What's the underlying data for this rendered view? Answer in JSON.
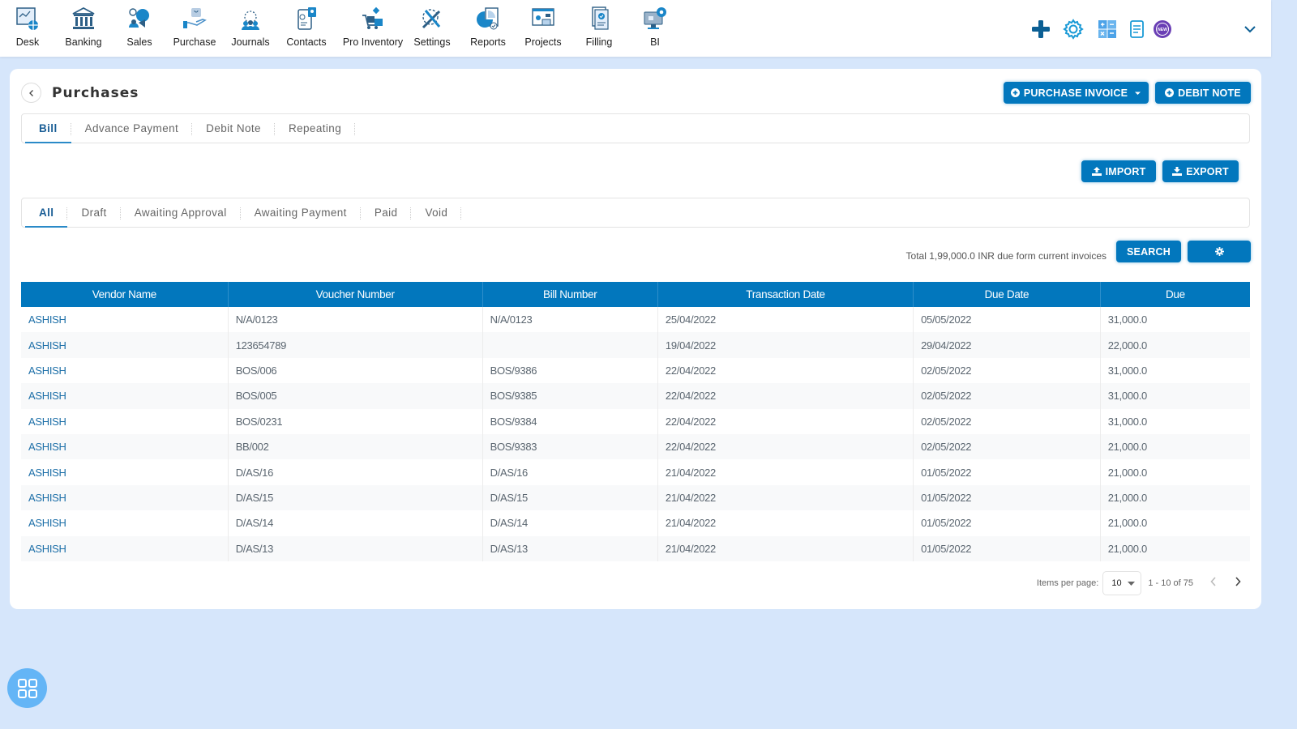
{
  "nav": {
    "items": [
      {
        "label": "Desk",
        "icon": "desk-icon"
      },
      {
        "label": "Banking",
        "icon": "bank-icon"
      },
      {
        "label": "Sales",
        "icon": "sales-icon"
      },
      {
        "label": "Purchase",
        "icon": "purchase-icon"
      },
      {
        "label": "Journals",
        "icon": "journals-icon"
      },
      {
        "label": "Contacts",
        "icon": "contacts-icon"
      },
      {
        "label": "Pro Inventory",
        "icon": "inventory-icon"
      },
      {
        "label": "Settings",
        "icon": "settings-icon"
      },
      {
        "label": "Reports",
        "icon": "reports-icon"
      },
      {
        "label": "Projects",
        "icon": "projects-icon"
      },
      {
        "label": "Filling",
        "icon": "filling-icon"
      },
      {
        "label": "BI",
        "icon": "bi-icon"
      }
    ],
    "tools": [
      "plus-icon",
      "gear-icon",
      "calculator-icon",
      "notes-icon",
      "new-badge-icon",
      "chevron-down-icon"
    ],
    "new_badge_text": "NEW"
  },
  "page": {
    "title": "Purchases",
    "purchase_invoice_label": "PURCHASE INVOICE",
    "debit_note_label": "DEBIT NOTE",
    "import_label": "IMPORT",
    "export_label": "EXPORT",
    "search_label": "SEARCH",
    "total_text": "Total 1,99,000.0 INR due form current invoices"
  },
  "main_tabs": [
    {
      "label": "Bill",
      "active": true
    },
    {
      "label": "Advance Payment",
      "active": false
    },
    {
      "label": "Debit Note",
      "active": false
    },
    {
      "label": "Repeating",
      "active": false
    }
  ],
  "status_tabs": [
    {
      "label": "All",
      "active": true
    },
    {
      "label": "Draft",
      "active": false
    },
    {
      "label": "Awaiting Approval",
      "active": false
    },
    {
      "label": "Awaiting Payment",
      "active": false
    },
    {
      "label": "Paid",
      "active": false
    },
    {
      "label": "Void",
      "active": false
    }
  ],
  "table": {
    "columns": [
      "Vendor Name",
      "Voucher Number",
      "Bill Number",
      "Transaction Date",
      "Due Date",
      "Due"
    ],
    "rows": [
      [
        "ASHISH",
        "N/A/0123",
        "N/A/0123",
        "25/04/2022",
        "05/05/2022",
        "31,000.0"
      ],
      [
        "ASHISH",
        "123654789",
        "",
        "19/04/2022",
        "29/04/2022",
        "22,000.0"
      ],
      [
        "ASHISH",
        "BOS/006",
        "BOS/9386",
        "22/04/2022",
        "02/05/2022",
        "31,000.0"
      ],
      [
        "ASHISH",
        "BOS/005",
        "BOS/9385",
        "22/04/2022",
        "02/05/2022",
        "31,000.0"
      ],
      [
        "ASHISH",
        "BOS/0231",
        "BOS/9384",
        "22/04/2022",
        "02/05/2022",
        "31,000.0"
      ],
      [
        "ASHISH",
        "BB/002",
        "BOS/9383",
        "22/04/2022",
        "02/05/2022",
        "21,000.0"
      ],
      [
        "ASHISH",
        "D/AS/16",
        "D/AS/16",
        "21/04/2022",
        "01/05/2022",
        "21,000.0"
      ],
      [
        "ASHISH",
        "D/AS/15",
        "D/AS/15",
        "21/04/2022",
        "01/05/2022",
        "21,000.0"
      ],
      [
        "ASHISH",
        "D/AS/14",
        "D/AS/14",
        "21/04/2022",
        "01/05/2022",
        "21,000.0"
      ],
      [
        "ASHISH",
        "D/AS/13",
        "D/AS/13",
        "21/04/2022",
        "01/05/2022",
        "21,000.0"
      ]
    ]
  },
  "pagination": {
    "items_per_page_label": "Items per page:",
    "items_per_page": "10",
    "range_text": "1 - 10 of 75"
  },
  "colors": {
    "primary": "#0277bd",
    "background": "#d6e6fb",
    "link": "#1d6fa8",
    "fab": "#64b5f6"
  }
}
